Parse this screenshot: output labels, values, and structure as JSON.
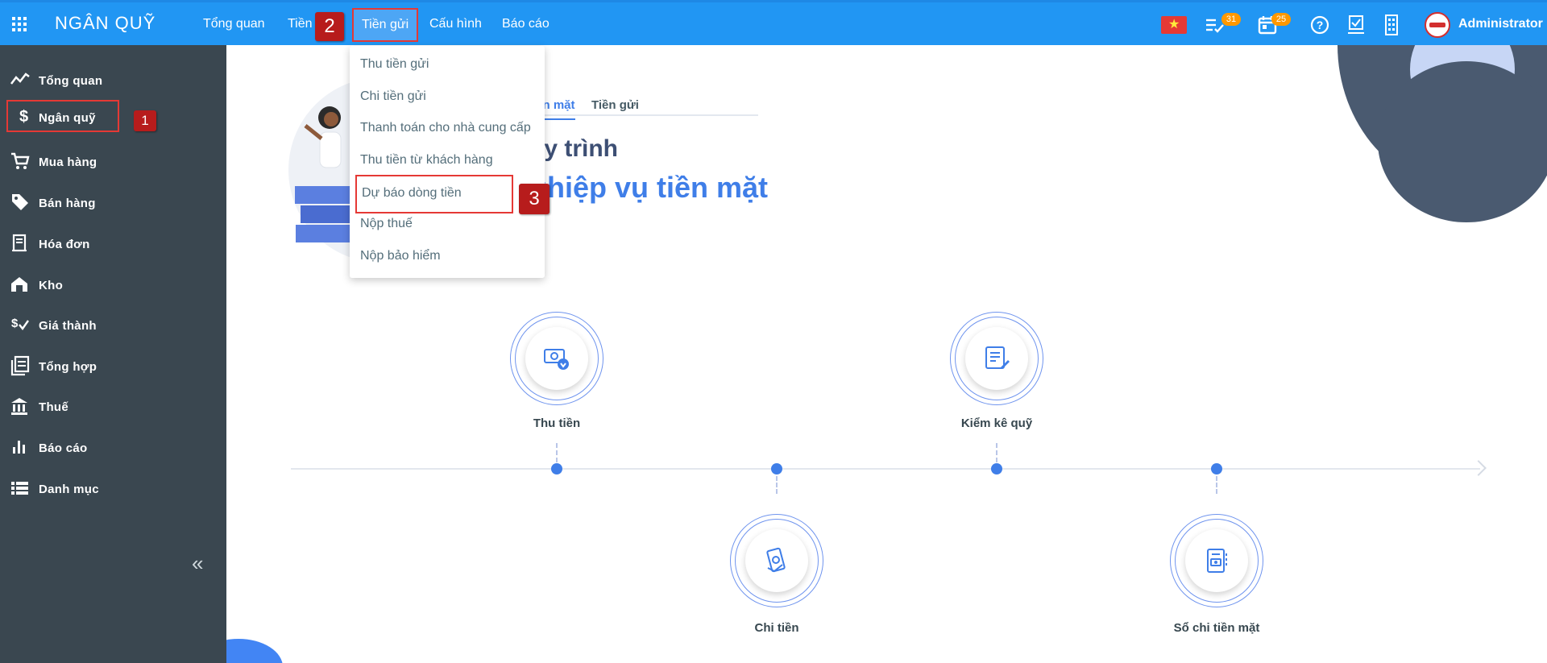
{
  "brand": "NGÂN QUỸ",
  "topnav": {
    "overview": "Tổng quan",
    "cash_partial": "Tiền",
    "deposit": "Tiền gửi",
    "config": "Cấu hình",
    "report": "Báo cáo"
  },
  "toolbar": {
    "tasks_count": "31",
    "calendar_count": "25",
    "username": "Administrator"
  },
  "sidebar": {
    "items": [
      {
        "label": "Tổng quan",
        "icon": "trend-icon"
      },
      {
        "label": "Ngân quỹ",
        "icon": "dollar-icon"
      },
      {
        "label": "Mua hàng",
        "icon": "cart-icon"
      },
      {
        "label": "Bán hàng",
        "icon": "tag-icon"
      },
      {
        "label": "Hóa đơn",
        "icon": "receipt-icon"
      },
      {
        "label": "Kho",
        "icon": "warehouse-icon"
      },
      {
        "label": "Giá thành",
        "icon": "cost-icon"
      },
      {
        "label": "Tổng hợp",
        "icon": "ledger-icon"
      },
      {
        "label": "Thuế",
        "icon": "bank-icon"
      },
      {
        "label": "Báo cáo",
        "icon": "bar-chart-icon"
      },
      {
        "label": "Danh mục",
        "icon": "list-icon"
      }
    ],
    "collapse": "«"
  },
  "markers": {
    "one": "1",
    "two": "2",
    "three": "3"
  },
  "dropdown": {
    "items": [
      "Thu tiền gửi",
      "Chi tiền gửi",
      "Thanh toán cho nhà cung cấp",
      "Thu tiền từ khách hàng",
      "Dự báo dòng tiền",
      "Nộp thuế",
      "Nộp bảo hiểm"
    ]
  },
  "main": {
    "tabs": [
      "iền mặt",
      "Tiền gửi"
    ],
    "title_line1": "uy trình",
    "title_line2": "ghiệp vụ tiền mặt",
    "steps": [
      "Thu tiền",
      "Chi tiền",
      "Kiểm kê quỹ",
      "Sổ chi tiền mặt"
    ]
  },
  "colors": {
    "topbar": "#2196f3",
    "sidebar": "#3a4750",
    "accent": "#3f7ee8",
    "highlight": "#e53935",
    "marker": "#b71c1c"
  }
}
